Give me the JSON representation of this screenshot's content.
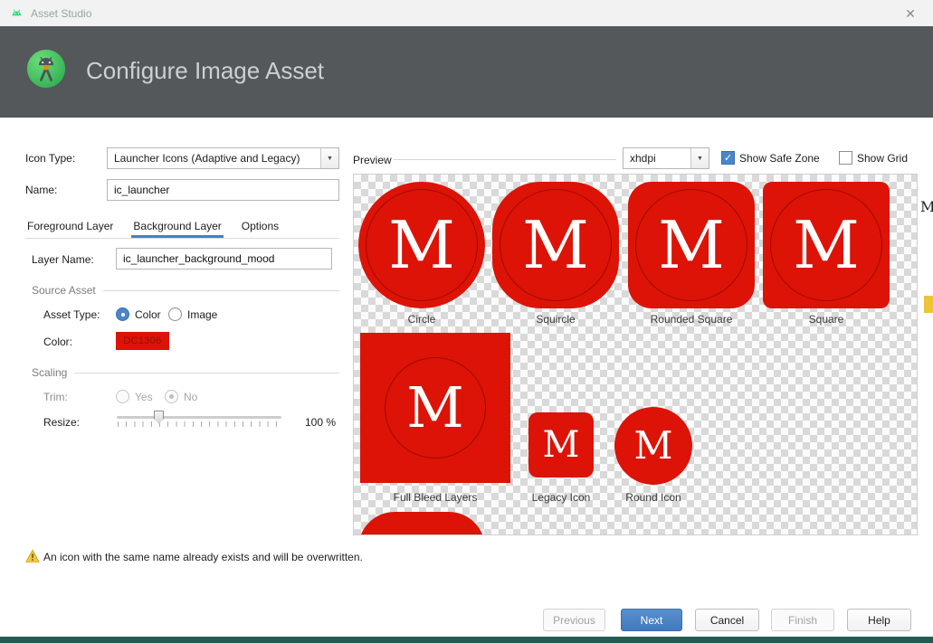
{
  "window": {
    "title": "Asset Studio",
    "close_glyph": "✕"
  },
  "icons": {
    "dropdown_arrow": "▼",
    "check": "✓"
  },
  "header": {
    "title": "Configure Image Asset"
  },
  "form": {
    "icon_type_label": "Icon Type:",
    "icon_type_value": "Launcher Icons (Adaptive and Legacy)",
    "name_label": "Name:",
    "name_value": "ic_launcher",
    "tabs": [
      {
        "label": "Foreground Layer"
      },
      {
        "label": "Background Layer"
      },
      {
        "label": "Options"
      }
    ],
    "active_tab": "Background Layer",
    "layer_name_label": "Layer Name:",
    "layer_name_value": "ic_launcher_background_mood",
    "source_asset_section": "Source Asset",
    "asset_type_label": "Asset Type:",
    "asset_type_options": [
      {
        "label": "Color",
        "selected": true
      },
      {
        "label": "Image",
        "selected": false
      }
    ],
    "color_label": "Color:",
    "color_value": "DC1306",
    "scaling_section": "Scaling",
    "trim_label": "Trim:",
    "trim_options": [
      {
        "label": "Yes",
        "selected": false
      },
      {
        "label": "No",
        "selected": true
      }
    ],
    "trim_enabled": false,
    "resize_label": "Resize:",
    "resize_percent": "100 %"
  },
  "preview": {
    "label": "Preview",
    "density_value": "xhdpi",
    "show_safe_zone_label": "Show Safe Zone",
    "show_safe_zone_checked": true,
    "show_grid_label": "Show Grid",
    "show_grid_checked": false,
    "icon_letter": "M",
    "items": [
      {
        "label": "Circle",
        "shape": "circle"
      },
      {
        "label": "Squircle",
        "shape": "squircle"
      },
      {
        "label": "Rounded Square",
        "shape": "rounded-square"
      },
      {
        "label": "Square",
        "shape": "square"
      },
      {
        "label": "Full Bleed Layers",
        "shape": "full-bleed"
      },
      {
        "label": "Legacy Icon",
        "shape": "legacy"
      },
      {
        "label": "Round Icon",
        "shape": "round"
      }
    ]
  },
  "warning": {
    "message": "An icon with the same name already exists and will be overwritten."
  },
  "footer": {
    "buttons": [
      {
        "label": "Previous",
        "enabled": false
      },
      {
        "label": "Next",
        "enabled": true,
        "primary": true
      },
      {
        "label": "Cancel",
        "enabled": true
      },
      {
        "label": "Finish",
        "enabled": false
      },
      {
        "label": "Help",
        "enabled": true
      }
    ]
  },
  "background": {
    "partial_text": "M"
  },
  "colors": {
    "icon_red": "#DC1306",
    "accent_blue": "#4083c9",
    "banner_gray": "#54585a"
  }
}
